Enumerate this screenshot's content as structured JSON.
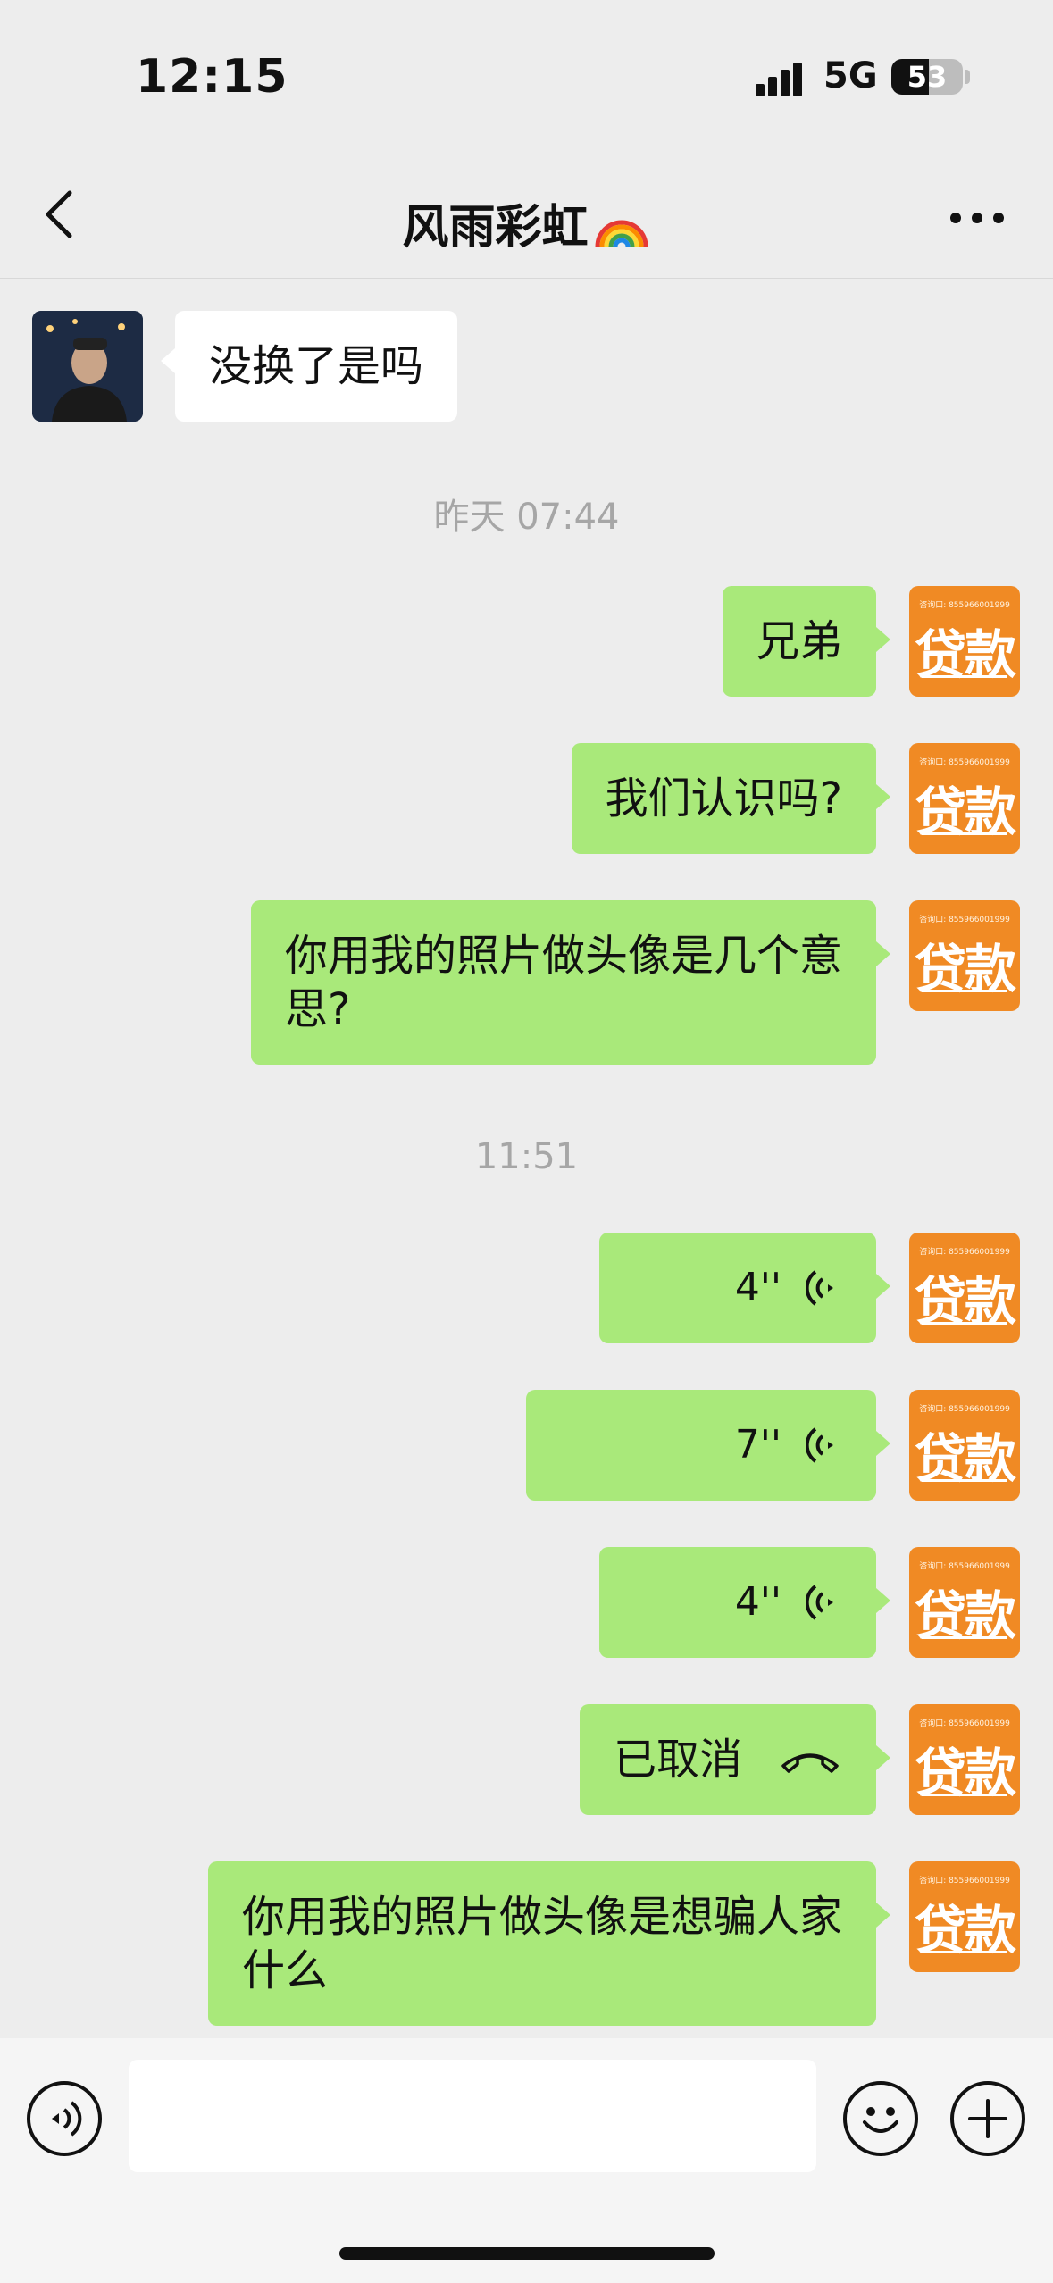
{
  "status_bar": {
    "time": "12:15",
    "network": "5G",
    "battery": "53",
    "battery_level": 0.53
  },
  "header": {
    "title": "风雨彩虹",
    "title_emoji": "rainbow-icon"
  },
  "messages": [
    {
      "type": "text",
      "side": "in",
      "text": "没换了是吗"
    },
    {
      "type": "timestamp",
      "text": "昨天 07:44"
    },
    {
      "type": "text",
      "side": "out",
      "text": "兄弟"
    },
    {
      "type": "text",
      "side": "out",
      "text": "我们认识吗?"
    },
    {
      "type": "text",
      "side": "out",
      "line1": "你用我的照片做头像是几个意",
      "line2": "思?"
    },
    {
      "type": "timestamp",
      "text": "11:51"
    },
    {
      "type": "voice",
      "side": "out",
      "duration": "4''"
    },
    {
      "type": "voice",
      "side": "out",
      "duration": "7''"
    },
    {
      "type": "voice",
      "side": "out",
      "duration": "4''"
    },
    {
      "type": "call",
      "side": "out",
      "text": "已取消"
    },
    {
      "type": "text",
      "side": "out",
      "line1": "你用我的照片做头像是想骗人家",
      "line2": "什么"
    }
  ],
  "self_avatar": {
    "small_text": "咨询口: 855966001999",
    "big_text": "贷款"
  },
  "input_bar": {
    "placeholder": ""
  },
  "colors": {
    "background": "#ededed",
    "outgoing_bubble": "#a9e97a",
    "incoming_bubble": "#ffffff",
    "avatar_orange": "#f08a24"
  }
}
